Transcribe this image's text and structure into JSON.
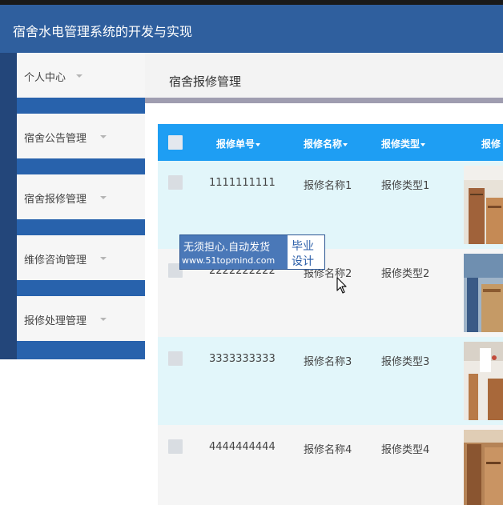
{
  "app": {
    "title": "宿舍水电管理系统的开发与实现"
  },
  "sidebar": {
    "items": [
      {
        "label": "个人中心"
      },
      {
        "label": "宿舍公告管理"
      },
      {
        "label": "宿舍报修管理"
      },
      {
        "label": "维修咨询管理"
      },
      {
        "label": "报修处理管理"
      }
    ]
  },
  "breadcrumb": {
    "current": "宿舍报修管理"
  },
  "table": {
    "columns": [
      "报修单号",
      "报修名称",
      "报修类型",
      "报修"
    ],
    "rows": [
      {
        "number": "1111111111",
        "name": "报修名称1",
        "type": "报修类型1"
      },
      {
        "number": "2222222222",
        "name": "报修名称2",
        "type": "报修类型2"
      },
      {
        "number": "3333333333",
        "name": "报修名称3",
        "type": "报修类型3"
      },
      {
        "number": "4444444444",
        "name": "报修名称4",
        "type": "报修类型4"
      }
    ]
  },
  "watermark": {
    "line1": "无须担心.自动发货",
    "line2": "www.51topmind.com",
    "badge_line1": "毕业",
    "badge_line2": "设计"
  },
  "colors": {
    "header": "#2f5f9e",
    "sidebar_accent": "#2862ac",
    "table_header": "#1e9ef3",
    "row_tint": "#e2f6fa"
  }
}
